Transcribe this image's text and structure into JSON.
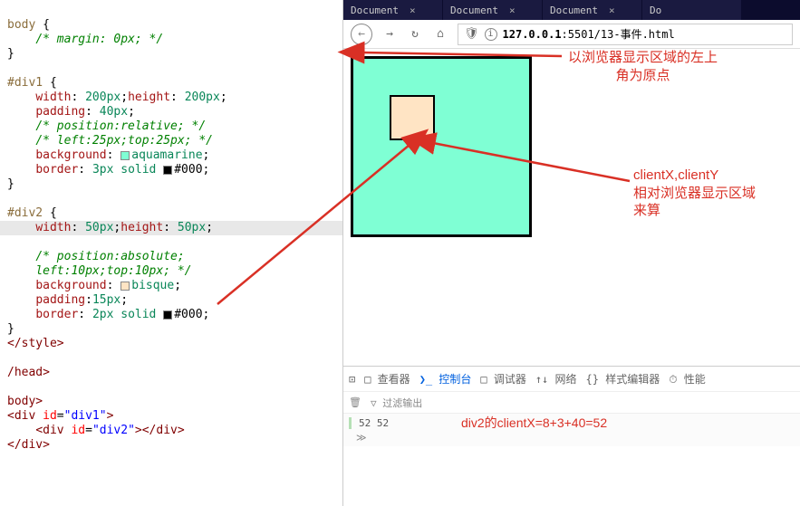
{
  "editor": {
    "body_sel": "body",
    "body_open": "{",
    "body_com": "/* margin: 0px; */",
    "body_close": "}",
    "d1_sel": "#div1",
    "d1_open": "{",
    "d1_w_prop": "width",
    "d1_w_val": "200px",
    "d1_h_prop": "height",
    "d1_h_val": "200px",
    "d1_pad_prop": "padding",
    "d1_pad_val": "40px",
    "d1_pos_com": "/* position:relative; */",
    "d1_lt_com": "/* left:25px;top:25px; */",
    "d1_bg_prop": "background",
    "d1_bg_val": "aquamarine",
    "d1_bd_prop": "border",
    "d1_bd_val": "3px solid ",
    "d1_bd_col": "#000",
    "d1_close": "}",
    "d2_sel": "#div2",
    "d2_open": "{",
    "d2_w_prop": "width",
    "d2_w_val": "50px",
    "d2_h_prop": "height",
    "d2_h_val": "50px",
    "d2_pos_com": "/* position:absolute;",
    "d2_lt_com": "left:10px;top:10px; */",
    "d2_bg_prop": "background",
    "d2_bg_val": "bisque",
    "d2_pad_prop": "padding",
    "d2_pad_val": "15px",
    "d2_bd_prop": "border",
    "d2_bd_val": "2px solid ",
    "d2_bd_col": "#000",
    "d2_close": "}",
    "style_close": "</style>",
    "head_close": "/head>",
    "body_tag": "body>",
    "div1_open": "<div ",
    "div1_attr": "id",
    "div1_eq": "=",
    "div1_val": "\"div1\"",
    "div1_gt": ">",
    "div2_open": "<div ",
    "div2_attr": "id",
    "div2_eq": "=",
    "div2_val": "\"div2\"",
    "div2_close": "></div>",
    "div1_close": "</div>"
  },
  "browser": {
    "tabs": [
      {
        "t": "Document",
        "x": "×"
      },
      {
        "t": "Document",
        "x": "×"
      },
      {
        "t": "Document",
        "x": "×"
      },
      {
        "t": "Do",
        "x": ""
      }
    ],
    "url_host": "127.0.0.1",
    "url_port": ":5501",
    "url_path": "/13-事件.html"
  },
  "annotations": {
    "topright_l1": "以浏览器显示区域的左上",
    "topright_l2": "角为原点",
    "right_l1": "clientX,clientY",
    "right_l2": "相对浏览器显示区域",
    "right_l3": "来算",
    "bottom": "div2的clientX=8+3+40=52"
  },
  "devtools": {
    "tab_inspect": "□ 查看器",
    "tab_console": "❯_ 控制台",
    "tab_debug": "□ 调试器",
    "tab_net": "↑↓ 网络",
    "tab_style": "{} 样式编辑器",
    "tab_perf": "⏱ 性能",
    "filter": "▽ 过滤输出",
    "out": "52 52",
    "more": "≫"
  },
  "colors": {
    "aquamarine": "#7fffd4",
    "bisque": "#ffe4c4",
    "black": "#000"
  }
}
